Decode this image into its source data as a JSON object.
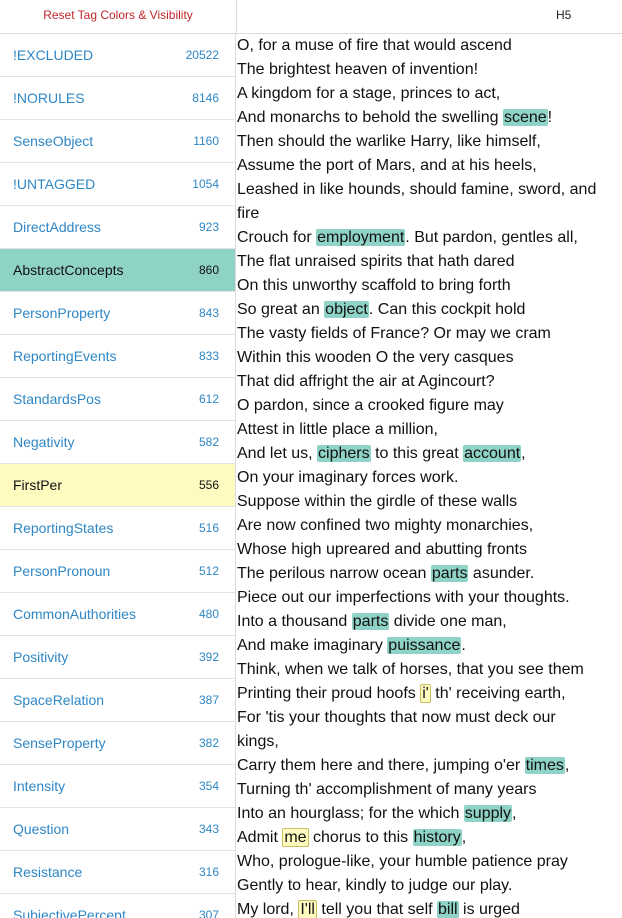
{
  "toolbar": {
    "reset_label": "Reset Tag Colors & Visibility",
    "heading": "H5"
  },
  "tags": [
    {
      "name": "!EXCLUDED",
      "count": "20522",
      "state": ""
    },
    {
      "name": "!NORULES",
      "count": "8146",
      "state": ""
    },
    {
      "name": "SenseObject",
      "count": "1160",
      "state": ""
    },
    {
      "name": "!UNTAGGED",
      "count": "1054",
      "state": ""
    },
    {
      "name": "DirectAddress",
      "count": "923",
      "state": ""
    },
    {
      "name": "AbstractConcepts",
      "count": "860",
      "state": "teal"
    },
    {
      "name": "PersonProperty",
      "count": "843",
      "state": ""
    },
    {
      "name": "ReportingEvents",
      "count": "833",
      "state": ""
    },
    {
      "name": "StandardsPos",
      "count": "612",
      "state": ""
    },
    {
      "name": "Negativity",
      "count": "582",
      "state": ""
    },
    {
      "name": "FirstPer",
      "count": "556",
      "state": "yellow"
    },
    {
      "name": "ReportingStates",
      "count": "516",
      "state": ""
    },
    {
      "name": "PersonPronoun",
      "count": "512",
      "state": ""
    },
    {
      "name": "CommonAuthorities",
      "count": "480",
      "state": ""
    },
    {
      "name": "Positivity",
      "count": "392",
      "state": ""
    },
    {
      "name": "SpaceRelation",
      "count": "387",
      "state": ""
    },
    {
      "name": "SenseProperty",
      "count": "382",
      "state": ""
    },
    {
      "name": "Intensity",
      "count": "354",
      "state": ""
    },
    {
      "name": "Question",
      "count": "343",
      "state": ""
    },
    {
      "name": "Resistance",
      "count": "316",
      "state": ""
    },
    {
      "name": "SubjectivePercept",
      "count": "307",
      "state": ""
    }
  ],
  "colors": {
    "abstract_concepts": "#8fd3c6",
    "first_person": "#fffbc0",
    "link": "#2e87c6",
    "reset": "#c0262b"
  },
  "lines": [
    [
      {
        "t": "O, for a muse of fire that would ascend"
      }
    ],
    [
      {
        "t": "The brightest heaven of invention!"
      }
    ],
    [
      {
        "t": "A kingdom for a stage, princes to act,"
      }
    ],
    [
      {
        "t": "And monarchs to behold the swelling "
      },
      {
        "t": "scene",
        "h": "teal"
      },
      {
        "t": "!"
      }
    ],
    [
      {
        "t": "Then should the warlike Harry, like himself,"
      }
    ],
    [
      {
        "t": "Assume the port of Mars, and at his heels,"
      }
    ],
    [
      {
        "t": "Leashed in like hounds, should famine, sword, and"
      }
    ],
    [
      {
        "t": "fire"
      }
    ],
    [
      {
        "t": "Crouch for "
      },
      {
        "t": "employment",
        "h": "teal"
      },
      {
        "t": ". But pardon, gentles all,"
      }
    ],
    [
      {
        "t": "The flat unraised spirits that hath dared"
      }
    ],
    [
      {
        "t": "On this unworthy scaffold to bring forth"
      }
    ],
    [
      {
        "t": "So great an "
      },
      {
        "t": "object",
        "h": "teal"
      },
      {
        "t": ". Can this cockpit hold"
      }
    ],
    [
      {
        "t": "The vasty fields of France? Or may we cram"
      }
    ],
    [
      {
        "t": "Within this wooden O the very casques"
      }
    ],
    [
      {
        "t": "That did affright the air at Agincourt?"
      }
    ],
    [
      {
        "t": "O pardon, since a crooked figure may"
      }
    ],
    [
      {
        "t": "Attest in little place a million,"
      }
    ],
    [
      {
        "t": "And let us, "
      },
      {
        "t": "ciphers",
        "h": "teal"
      },
      {
        "t": " to this great "
      },
      {
        "t": "account",
        "h": "teal"
      },
      {
        "t": ","
      }
    ],
    [
      {
        "t": "On your imaginary forces work."
      }
    ],
    [
      {
        "t": "Suppose within the girdle of these walls"
      }
    ],
    [
      {
        "t": "Are now confined two mighty monarchies,"
      }
    ],
    [
      {
        "t": "Whose high upreared and abutting fronts"
      }
    ],
    [
      {
        "t": "The perilous narrow ocean "
      },
      {
        "t": "parts",
        "h": "teal"
      },
      {
        "t": " asunder."
      }
    ],
    [
      {
        "t": "Piece out our imperfections with your thoughts."
      }
    ],
    [
      {
        "t": "Into a thousand "
      },
      {
        "t": "parts",
        "h": "teal"
      },
      {
        "t": " divide one man,"
      }
    ],
    [
      {
        "t": "And make imaginary "
      },
      {
        "t": "puissance",
        "h": "teal"
      },
      {
        "t": "."
      }
    ],
    [
      {
        "t": "Think, when we talk of horses, that you see them"
      }
    ],
    [
      {
        "t": "Printing their proud hoofs "
      },
      {
        "t": "i'",
        "h": "yellow"
      },
      {
        "t": " th' receiving earth,"
      }
    ],
    [
      {
        "t": "For 'tis your thoughts that now must deck our"
      }
    ],
    [
      {
        "t": "kings,"
      }
    ],
    [
      {
        "t": "Carry them here and there, jumping o'er "
      },
      {
        "t": "times",
        "h": "teal"
      },
      {
        "t": ","
      }
    ],
    [
      {
        "t": "Turning th' accomplishment of many years"
      }
    ],
    [
      {
        "t": "Into an hourglass; for the which "
      },
      {
        "t": "supply",
        "h": "teal"
      },
      {
        "t": ","
      }
    ],
    [
      {
        "t": "Admit "
      },
      {
        "t": "me",
        "h": "yellow"
      },
      {
        "t": " chorus to this "
      },
      {
        "t": "history",
        "h": "teal"
      },
      {
        "t": ","
      }
    ],
    [
      {
        "t": "Who, prologue-like, your humble patience pray"
      }
    ],
    [
      {
        "t": "Gently to hear, kindly to judge our play."
      }
    ],
    [
      {
        "t": "My lord, "
      },
      {
        "t": "I'll",
        "h": "yellow"
      },
      {
        "t": " tell you that self "
      },
      {
        "t": "bill",
        "h": "teal"
      },
      {
        "t": " is urged"
      }
    ]
  ]
}
